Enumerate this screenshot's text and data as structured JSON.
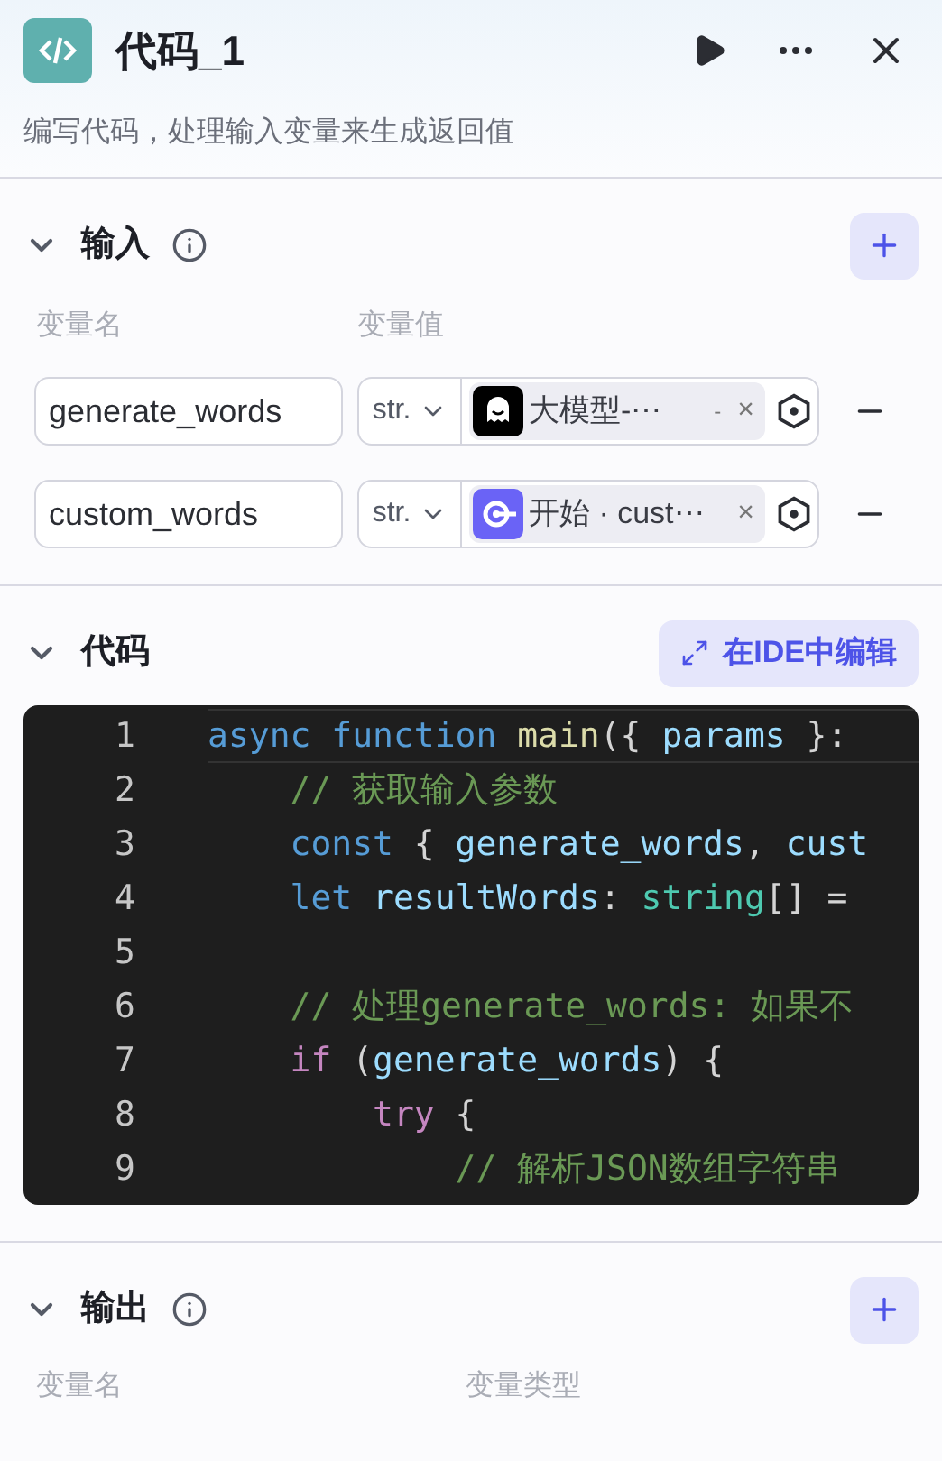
{
  "header": {
    "title": "代码_1",
    "description": "编写代码，处理输入变量来生成返回值"
  },
  "input_section": {
    "title": "输入",
    "expanded": true,
    "columns": [
      "变量名",
      "变量值"
    ],
    "rows": [
      {
        "name": "generate_words",
        "type": "str.",
        "ref": {
          "kind": "llm",
          "label": "大模型-⋯",
          "detail": "-",
          "remove": "×"
        }
      },
      {
        "name": "custom_words",
        "type": "str.",
        "ref": {
          "kind": "start",
          "label": "开始 · cust⋯",
          "remove": "×"
        }
      }
    ]
  },
  "code_section": {
    "title": "代码",
    "expanded": true,
    "ide_button": "在IDE中编辑",
    "lines": [
      {
        "number": "1",
        "active": true,
        "tokens": [
          {
            "kind": "keyword",
            "text": "async function "
          },
          {
            "kind": "function",
            "text": "main"
          },
          {
            "kind": "punct",
            "text": "({ "
          },
          {
            "kind": "variable",
            "text": "params"
          },
          {
            "kind": "punct",
            "text": " }:"
          }
        ]
      },
      {
        "number": "2",
        "active": false,
        "tokens": [
          {
            "kind": "comment",
            "text": "    // 获取输入参数"
          }
        ]
      },
      {
        "number": "3",
        "active": false,
        "tokens": [
          {
            "kind": "keyword",
            "text": "    const "
          },
          {
            "kind": "punct",
            "text": "{ "
          },
          {
            "kind": "variable",
            "text": "generate_words"
          },
          {
            "kind": "punct",
            "text": ", "
          },
          {
            "kind": "variable",
            "text": "cust"
          }
        ]
      },
      {
        "number": "4",
        "active": false,
        "tokens": [
          {
            "kind": "keyword",
            "text": "    let "
          },
          {
            "kind": "variable",
            "text": "resultWords"
          },
          {
            "kind": "punct",
            "text": ": "
          },
          {
            "kind": "type",
            "text": "string"
          },
          {
            "kind": "punct",
            "text": "[] ="
          }
        ]
      },
      {
        "number": "5",
        "active": false
      },
      {
        "number": "6",
        "active": false,
        "tokens": [
          {
            "kind": "comment",
            "text": "    // 处理generate_words: 如果不"
          }
        ]
      },
      {
        "number": "7",
        "active": false,
        "tokens": [
          {
            "kind": "control",
            "text": "    if "
          },
          {
            "kind": "punct",
            "text": "("
          },
          {
            "kind": "variable",
            "text": "generate_words"
          },
          {
            "kind": "punct",
            "text": ") {"
          }
        ]
      },
      {
        "number": "8",
        "active": false,
        "tokens": [
          {
            "kind": "control",
            "text": "        try "
          },
          {
            "kind": "punct",
            "text": "{"
          }
        ]
      },
      {
        "number": "9",
        "active": false,
        "tokens": [
          {
            "kind": "comment",
            "text": "            // 解析JSON数组字符串"
          }
        ]
      }
    ]
  },
  "output_section": {
    "title": "输出",
    "expanded": true,
    "columns": [
      "变量名",
      "变量类型"
    ]
  }
}
